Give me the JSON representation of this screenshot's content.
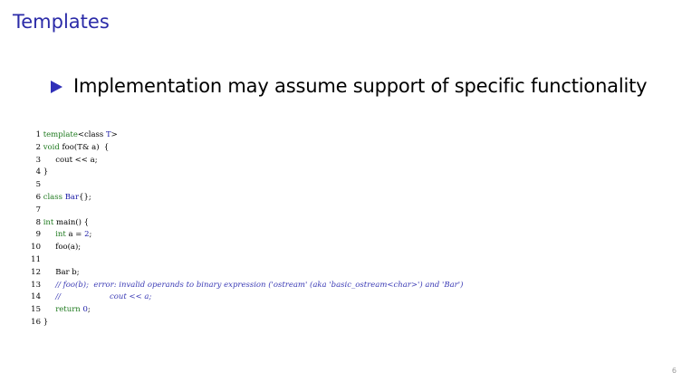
{
  "slide": {
    "title": "Templates",
    "bullet": "Implementation may assume support of specific functionality",
    "page_number": "6"
  },
  "code": {
    "line_numbers": [
      "1",
      "2",
      "3",
      "4",
      "5",
      "6",
      "7",
      "8",
      "9",
      "10",
      "11",
      "12",
      "13",
      "14",
      "15",
      "16"
    ],
    "l1": {
      "kw": "template",
      "rest": "<class ",
      "ty": "T",
      "end": ">"
    },
    "l2": {
      "kw": "void",
      "rest": " foo(T& a)  {"
    },
    "l3": {
      "text": "      cout << a;"
    },
    "l4": {
      "text": " }"
    },
    "l6": {
      "kw": "class",
      "ty": "Bar",
      "rest": "{};"
    },
    "l8": {
      "kw": "int",
      "rest": " main() {"
    },
    "l9": {
      "indent": "      ",
      "kw": "int",
      "rest": " a = ",
      "num": "2",
      "end": ";"
    },
    "l10": {
      "text": "      foo(a);"
    },
    "l12": {
      "text": "      Bar b;"
    },
    "l13": {
      "indent": "      ",
      "comment": "// foo(b);  error: invalid operands to binary expression ('ostream' (aka 'basic_ostream<char>') and 'Bar')"
    },
    "l14": {
      "indent": "      ",
      "comment": "//                    cout << a;"
    },
    "l15": {
      "indent": "      ",
      "kw": "return",
      "num": "0",
      "end": ";"
    },
    "l16": {
      "text": " }"
    }
  }
}
